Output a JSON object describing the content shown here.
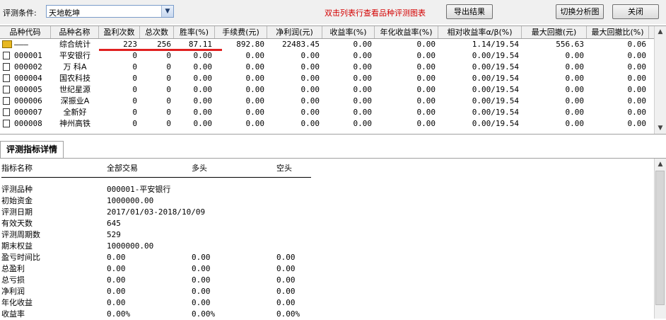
{
  "toolbar": {
    "condition_label": "评测条件:",
    "condition_value": "天地乾坤",
    "hint": "双击列表行查看品种评测图表",
    "export_label": "导出结果",
    "switch_label": "切换分析图",
    "close_label": "关闭"
  },
  "grid": {
    "columns": [
      "品种代码",
      "品种名称",
      "盈利次数",
      "总次数",
      "胜率(%)",
      "手续费(元)",
      "净利润(元)",
      "收益率(%)",
      "年化收益率(%)",
      "相对收益率α/β(%)",
      "最大回撤(元)",
      "最大回撤比(%)"
    ],
    "rows": [
      {
        "code": "———",
        "name": "综合统计",
        "win": "223",
        "total": "256",
        "rate": "87.11",
        "fee": "892.80",
        "profit": "22483.45",
        "ret": "0.00",
        "annual": "0.00",
        "ab": "1.14/19.54",
        "dd": "556.63",
        "ddr": "0.06"
      },
      {
        "code": "000001",
        "name": "平安银行",
        "win": "0",
        "total": "0",
        "rate": "0.00",
        "fee": "0.00",
        "profit": "0.00",
        "ret": "0.00",
        "annual": "0.00",
        "ab": "0.00/19.54",
        "dd": "0.00",
        "ddr": "0.00"
      },
      {
        "code": "000002",
        "name": "万 科A",
        "win": "0",
        "total": "0",
        "rate": "0.00",
        "fee": "0.00",
        "profit": "0.00",
        "ret": "0.00",
        "annual": "0.00",
        "ab": "0.00/19.54",
        "dd": "0.00",
        "ddr": "0.00"
      },
      {
        "code": "000004",
        "name": "国农科技",
        "win": "0",
        "total": "0",
        "rate": "0.00",
        "fee": "0.00",
        "profit": "0.00",
        "ret": "0.00",
        "annual": "0.00",
        "ab": "0.00/19.54",
        "dd": "0.00",
        "ddr": "0.00"
      },
      {
        "code": "000005",
        "name": "世纪星源",
        "win": "0",
        "total": "0",
        "rate": "0.00",
        "fee": "0.00",
        "profit": "0.00",
        "ret": "0.00",
        "annual": "0.00",
        "ab": "0.00/19.54",
        "dd": "0.00",
        "ddr": "0.00"
      },
      {
        "code": "000006",
        "name": "深振业A",
        "win": "0",
        "total": "0",
        "rate": "0.00",
        "fee": "0.00",
        "profit": "0.00",
        "ret": "0.00",
        "annual": "0.00",
        "ab": "0.00/19.54",
        "dd": "0.00",
        "ddr": "0.00"
      },
      {
        "code": "000007",
        "name": "全新好",
        "win": "0",
        "total": "0",
        "rate": "0.00",
        "fee": "0.00",
        "profit": "0.00",
        "ret": "0.00",
        "annual": "0.00",
        "ab": "0.00/19.54",
        "dd": "0.00",
        "ddr": "0.00"
      },
      {
        "code": "000008",
        "name": "神州高铁",
        "win": "0",
        "total": "0",
        "rate": "0.00",
        "fee": "0.00",
        "profit": "0.00",
        "ret": "0.00",
        "annual": "0.00",
        "ab": "0.00/19.54",
        "dd": "0.00",
        "ddr": "0.00"
      }
    ]
  },
  "tab": {
    "label": "评测指标详情"
  },
  "detail": {
    "headers": [
      "指标名称",
      "全部交易",
      "多头",
      "空头"
    ],
    "rows": [
      {
        "name": "评测品种",
        "all": "000001-平安银行",
        "long": "",
        "short": ""
      },
      {
        "name": "初始资金",
        "all": "1000000.00",
        "long": "",
        "short": ""
      },
      {
        "name": "评测日期",
        "all": "2017/01/03-2018/10/09",
        "long": "",
        "short": ""
      },
      {
        "name": "有效天数",
        "all": "645",
        "long": "",
        "short": ""
      },
      {
        "name": "评测周期数",
        "all": "529",
        "long": "",
        "short": ""
      },
      {
        "name": "期末权益",
        "all": "1000000.00",
        "long": "",
        "short": ""
      },
      {
        "name": "盈亏时间比",
        "all": "0.00",
        "long": "0.00",
        "short": "0.00"
      },
      {
        "name": "总盈利",
        "all": "0.00",
        "long": "0.00",
        "short": "0.00"
      },
      {
        "name": "总亏损",
        "all": "0.00",
        "long": "0.00",
        "short": "0.00"
      },
      {
        "name": "净利润",
        "all": "0.00",
        "long": "0.00",
        "short": "0.00"
      },
      {
        "name": "年化收益",
        "all": "0.00",
        "long": "0.00",
        "short": "0.00"
      },
      {
        "name": "收益率",
        "all": "0.00%",
        "long": "0.00%",
        "short": "0.00%"
      }
    ]
  },
  "colors": {
    "hint": "#d40000",
    "underline": "#e02020",
    "folder": "#e8b820"
  }
}
